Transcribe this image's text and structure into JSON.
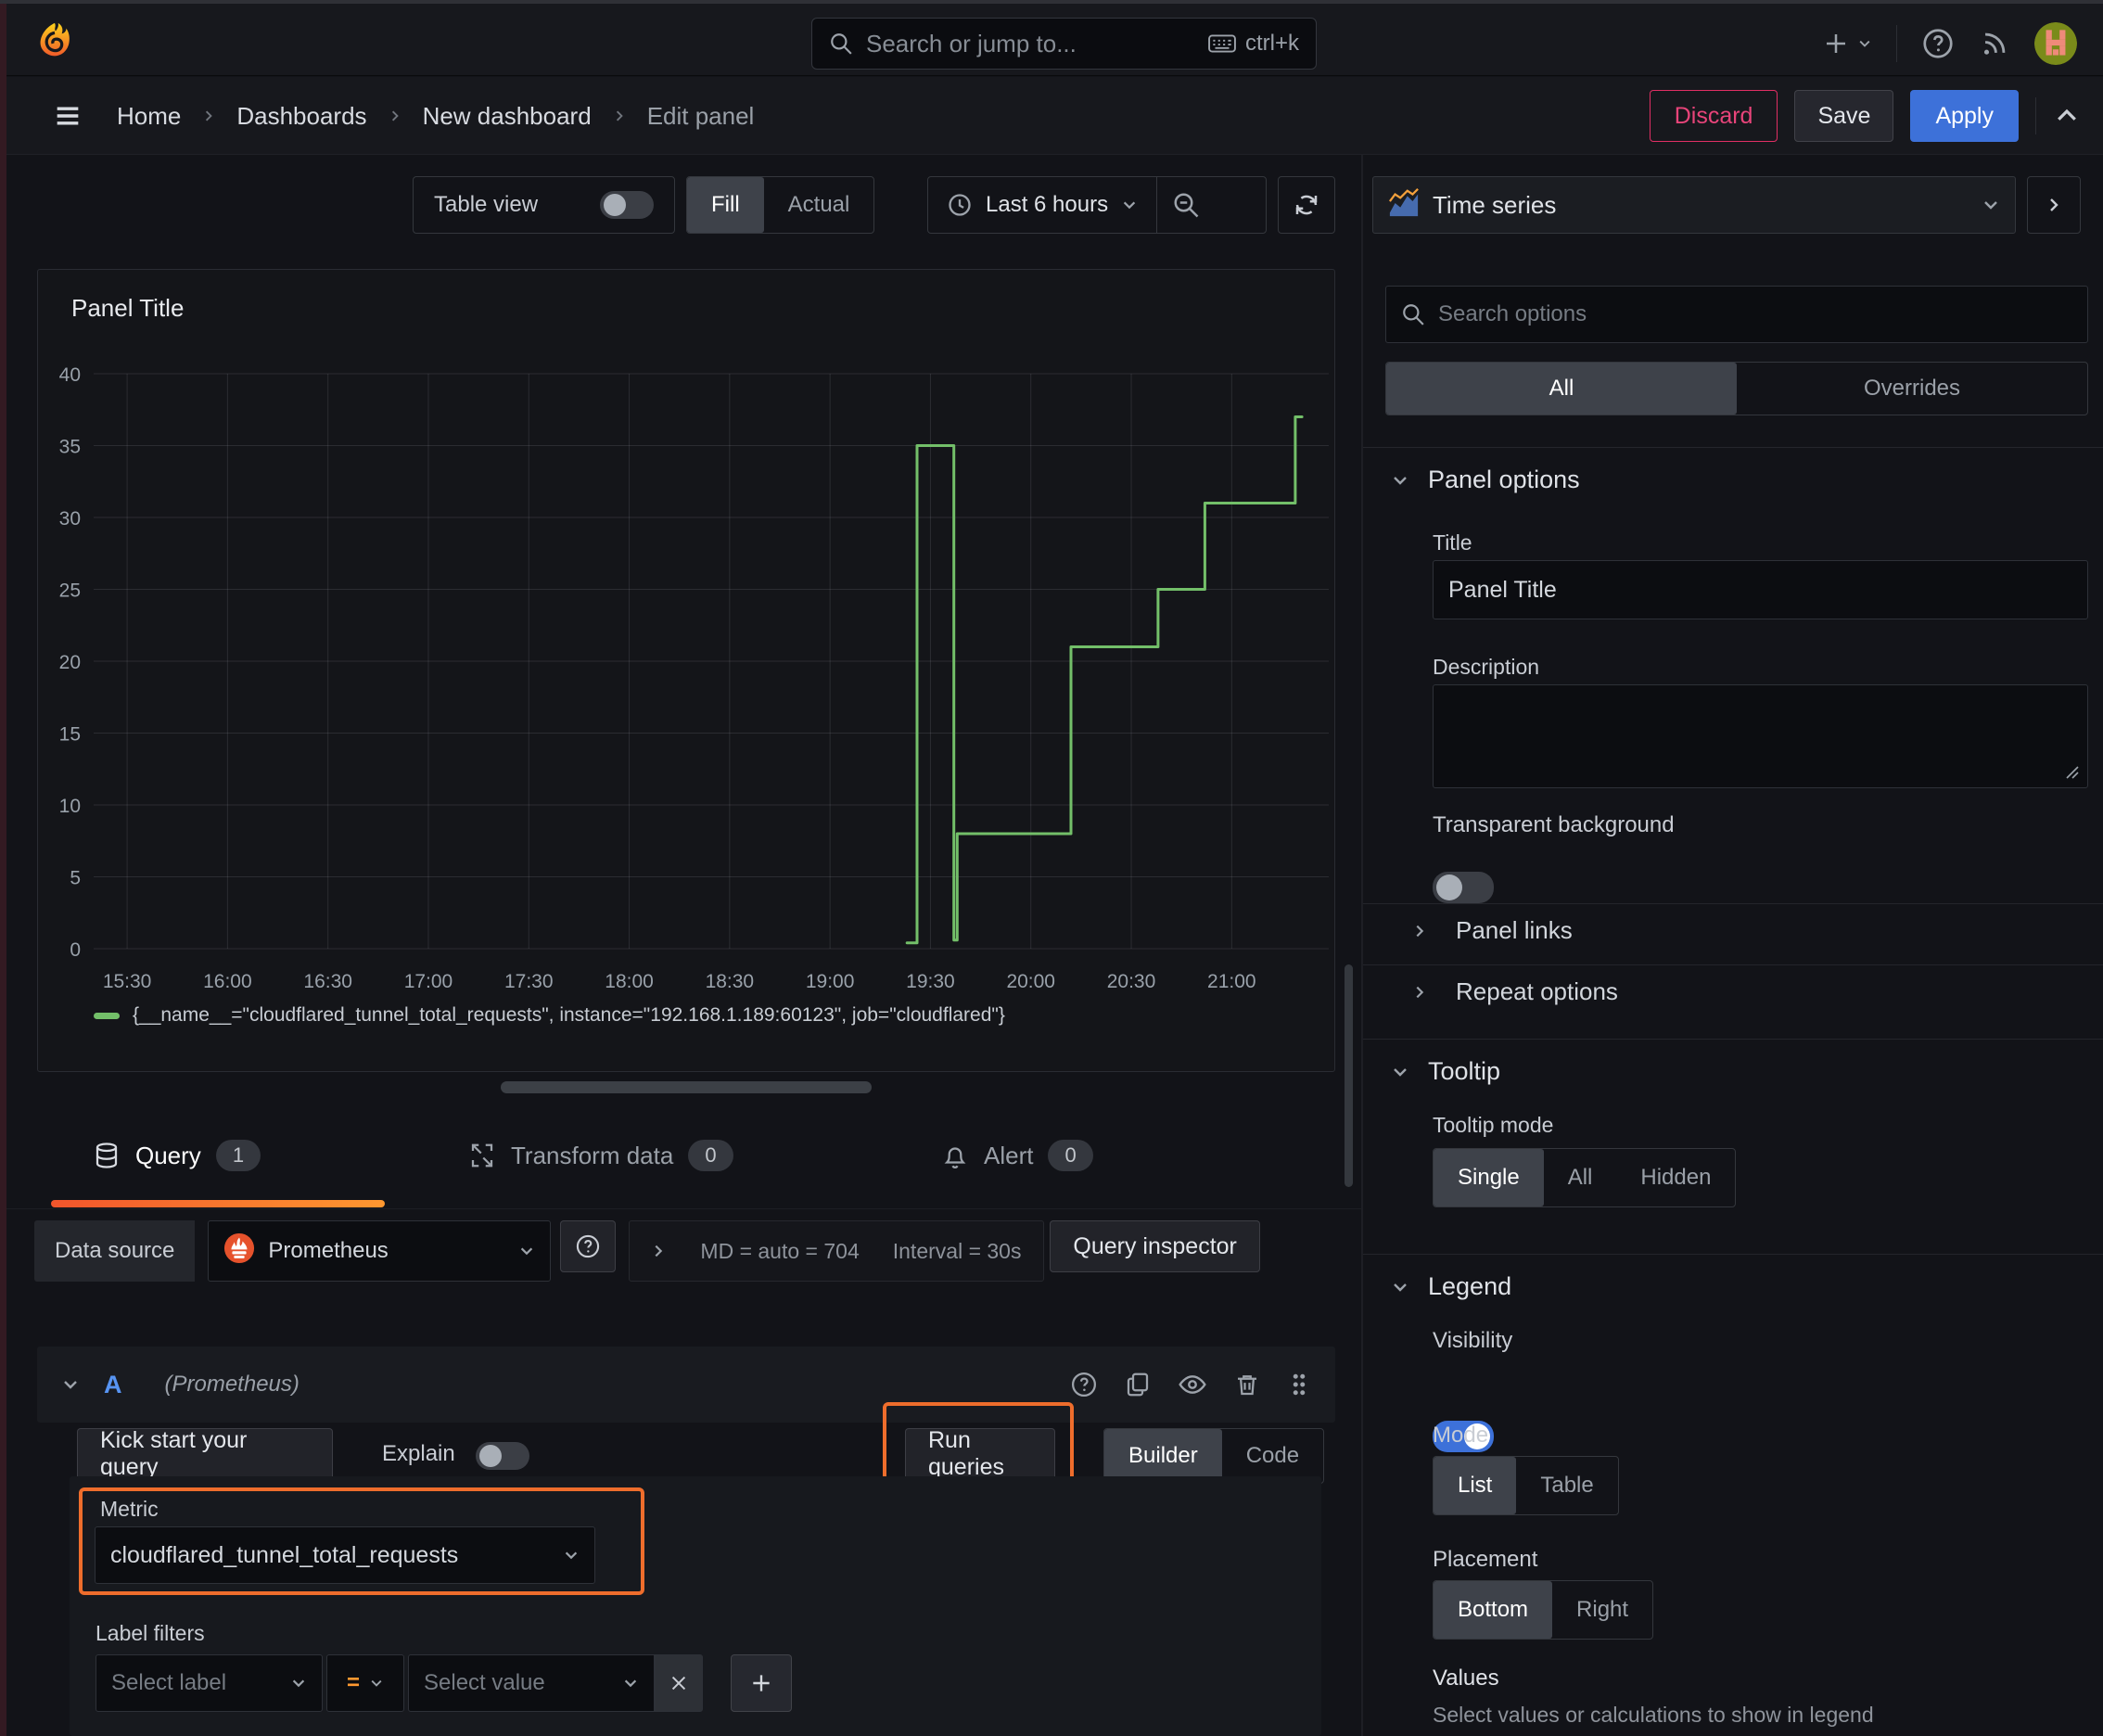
{
  "topbar": {
    "search_placeholder": "Search or jump to...",
    "shortcut": "ctrl+k"
  },
  "breadcrumb": {
    "home": "Home",
    "dashboards": "Dashboards",
    "new_dashboard": "New dashboard",
    "current": "Edit panel",
    "discard": "Discard",
    "save": "Save",
    "apply": "Apply"
  },
  "toolbar": {
    "table_view": "Table view",
    "fill": "Fill",
    "actual": "Actual",
    "time_range": "Last 6 hours"
  },
  "panel": {
    "title": "Panel Title",
    "legend": "{__name__=\"cloudflared_tunnel_total_requests\", instance=\"192.168.1.189:60123\", job=\"cloudflared\"}"
  },
  "chart_data": {
    "type": "line",
    "title": "Panel Title",
    "xlabel": "",
    "ylabel": "",
    "x_ticks": [
      "15:30",
      "16:00",
      "16:30",
      "17:00",
      "17:30",
      "18:00",
      "18:30",
      "19:00",
      "19:30",
      "20:00",
      "20:30",
      "21:00"
    ],
    "y_ticks": [
      0,
      5,
      10,
      15,
      20,
      25,
      30,
      35,
      40
    ],
    "ylim": [
      0,
      40
    ],
    "x_range": [
      "15:20",
      "21:29"
    ],
    "grid": true,
    "legend_position": "bottom",
    "series": [
      {
        "name": "{__name__=\"cloudflared_tunnel_total_requests\", instance=\"192.168.1.189:60123\", job=\"cloudflared\"}",
        "color": "#73bf69",
        "points": [
          [
            "19:23",
            0.4
          ],
          [
            "19:26",
            0.4
          ],
          [
            "19:26",
            35
          ],
          [
            "19:37",
            35
          ],
          [
            "19:37",
            0.6
          ],
          [
            "19:38",
            0.6
          ],
          [
            "19:38",
            8
          ],
          [
            "20:12",
            8
          ],
          [
            "20:12",
            21
          ],
          [
            "20:38",
            21
          ],
          [
            "20:38",
            25
          ],
          [
            "20:52",
            25
          ],
          [
            "20:52",
            31
          ],
          [
            "21:19",
            31
          ],
          [
            "21:19",
            37
          ],
          [
            "21:21",
            37
          ]
        ]
      }
    ]
  },
  "tabs": {
    "query": "Query",
    "query_count": "1",
    "transform": "Transform data",
    "transform_count": "0",
    "alert": "Alert",
    "alert_count": "0"
  },
  "datasource": {
    "label": "Data source",
    "name": "Prometheus",
    "md": "MD = auto = 704",
    "interval": "Interval = 30s",
    "inspector": "Query inspector"
  },
  "query_row": {
    "ref": "A",
    "ds": "(Prometheus)"
  },
  "editor": {
    "kickstart": "Kick start your query",
    "explain": "Explain",
    "run": "Run queries",
    "builder": "Builder",
    "code": "Code",
    "metric_label": "Metric",
    "metric_value": "cloudflared_tunnel_total_requests",
    "filters_label": "Label filters",
    "select_label": "Select label",
    "op": "=",
    "select_value": "Select value"
  },
  "sidebar": {
    "visualization": "Time series",
    "search_placeholder": "Search options",
    "tab_all": "All",
    "tab_overrides": "Overrides",
    "panel_options": {
      "header": "Panel options",
      "title_label": "Title",
      "title_value": "Panel Title",
      "description_label": "Description",
      "transparent_label": "Transparent background"
    },
    "panel_links": "Panel links",
    "repeat_options": "Repeat options",
    "tooltip": {
      "header": "Tooltip",
      "mode_label": "Tooltip mode",
      "options": [
        "Single",
        "All",
        "Hidden"
      ],
      "selected": "Single"
    },
    "legend": {
      "header": "Legend",
      "visibility_label": "Visibility",
      "mode_label": "Mode",
      "mode_options": [
        "List",
        "Table"
      ],
      "mode_selected": "List",
      "placement_label": "Placement",
      "placement_options": [
        "Bottom",
        "Right"
      ],
      "placement_selected": "Bottom",
      "values_label": "Values",
      "values_desc": "Select values or calculations to show in legend"
    }
  },
  "colors": {
    "accent_orange": "#ee6d2c",
    "tab_gradient": [
      "#f2552c",
      "#ff9830"
    ],
    "series_green": "#73bf69",
    "primary_blue": "#3d71d9",
    "danger_red": "#e02f64"
  }
}
